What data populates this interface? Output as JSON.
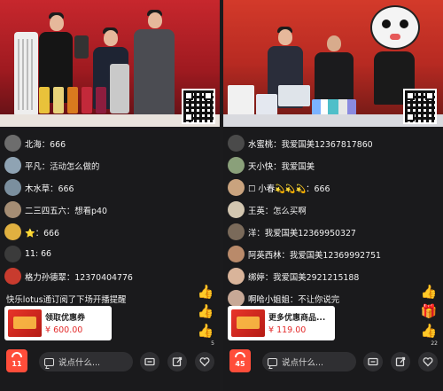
{
  "panels": [
    {
      "id": "left",
      "brand_text": "",
      "comments": [
        {
          "user": "北海",
          "text": "666",
          "avatar_color": "#6d6d6d"
        },
        {
          "user": "平凡",
          "text": "活动怎么做的",
          "avatar_color": "#8fa3b3"
        },
        {
          "user": "木水草",
          "text": "666",
          "avatar_color": "#7b8f9e"
        },
        {
          "user": "二三四五六",
          "text": "想看p40",
          "avatar_color": "#a58d74"
        },
        {
          "user": "⭐",
          "text": "666",
          "avatar_color": "#e0b040"
        },
        {
          "user": "11",
          "text": "66",
          "avatar_color": "#3b3b3b"
        },
        {
          "user": "格力孙德翠",
          "text": "12370404776",
          "avatar_color": "#c83b2e"
        }
      ],
      "notice": "快乐lotus通订阅了下场开播提醒",
      "coupon": {
        "title": "领取优惠券",
        "price": "¥ 600.00"
      },
      "like_count": "5",
      "cart_count": "11",
      "input_placeholder": "说点什么...",
      "icons": [
        "cart-icon",
        "chat-icon",
        "coupon-icon",
        "share-icon",
        "heart-icon"
      ]
    },
    {
      "id": "right",
      "brand_text": "",
      "big_text": "",
      "comments": [
        {
          "user": "水蜜桃",
          "text": "我爱国美12367817860",
          "avatar_color": "#4a4a4a"
        },
        {
          "user": "天小快",
          "text": "我爱国美",
          "avatar_color": "#8aa07a"
        },
        {
          "user": "☐ 小春💫💫💫",
          "text": "666",
          "avatar_color": "#c9a37e"
        },
        {
          "user": "王英",
          "text": "怎么买啊",
          "avatar_color": "#d3c6b0"
        },
        {
          "user": "洋",
          "text": "我爱国美12369950327",
          "avatar_color": "#7a6a5a"
        },
        {
          "user": "阿英西林",
          "text": "我爱国美12369992751",
          "avatar_color": "#b98a6a"
        },
        {
          "user": "绑婷",
          "text": "我爱国美2921215188",
          "avatar_color": "#d9b49a"
        },
        {
          "user": "啊哈小姐姐",
          "text": "不让你说完",
          "avatar_color": "#c7a896"
        }
      ],
      "coupon": {
        "title": "更多优惠商品...",
        "price": "¥ 119.00"
      },
      "like_count": "22",
      "cart_count": "45",
      "input_placeholder": "说点什么...",
      "icons": [
        "cart-icon",
        "chat-icon",
        "coupon-icon",
        "share-icon",
        "heart-icon"
      ]
    }
  ],
  "colors": {
    "accent": "#ff4d3a",
    "price": "#e32b2b",
    "background": "#1a1a1c",
    "thumb": "#f2b23a"
  }
}
